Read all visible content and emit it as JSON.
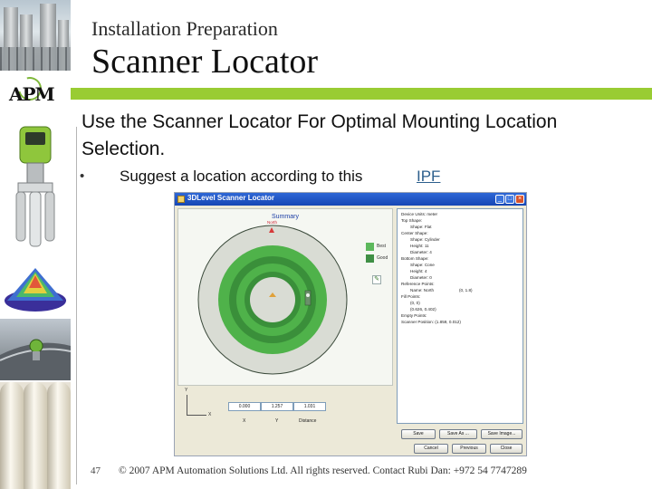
{
  "slide": {
    "subtitle": "Installation Preparation",
    "title": "Scanner Locator",
    "lead": "Use the Scanner Locator For Optimal Mounting Location Selection.",
    "bullet_marker": "•",
    "bullet_text": "Suggest a location  according to this",
    "bullet_link": "IPF",
    "page_number": "47",
    "copyright": "© 2007 APM Automation Solutions Ltd. All rights reserved. Contact Rubi Dan: +972 54 7747289",
    "accent_color": "#99cc33"
  },
  "logo": {
    "text": "APM"
  },
  "window": {
    "title": "3DLevel Scanner Locator",
    "minimize_icon": "minimize-icon",
    "maximize_icon": "maximize-icon",
    "close_icon": "close-icon",
    "plot": {
      "title": "Summary",
      "north_label": "North",
      "legend": [
        {
          "label": "Best",
          "color": "#5cb85c"
        },
        {
          "label": "Good",
          "color": "#3f8f45"
        }
      ],
      "ring_outer_color": "#4fb24a",
      "ring_inner_color": "#3a8f3a",
      "background_color": "#d9dcd4"
    },
    "coords": {
      "x_value": "0.000",
      "y_value": "1.257",
      "distance_value": "1.031",
      "x_label": "X",
      "y_label": "Y",
      "distance_label": "Distance",
      "axis_y": "Y",
      "axis_x": "X"
    },
    "properties": [
      "Device Units: meter",
      "Top Shape:",
      "Shape: Flat",
      "Center Shape:",
      "Shape: Cylinder",
      "Height: 11",
      "Diameter: 4",
      "Bottom Shape:",
      "Shape: Cone",
      "Height: 4",
      "Diameter: 0",
      "Reference Points:",
      "Name: North",
      "(0, 1.8)",
      "Fill Points:",
      "(0, 0)",
      "(0.626, 0.402)",
      "Empty Points:",
      "Scanner Position: (1.859, 0.012)"
    ],
    "buttons": {
      "save": "Save",
      "save_as": "Save As ...",
      "save_image": "Save Image...",
      "cancel": "Cancel",
      "previous": "Previous",
      "close": "Close"
    }
  }
}
